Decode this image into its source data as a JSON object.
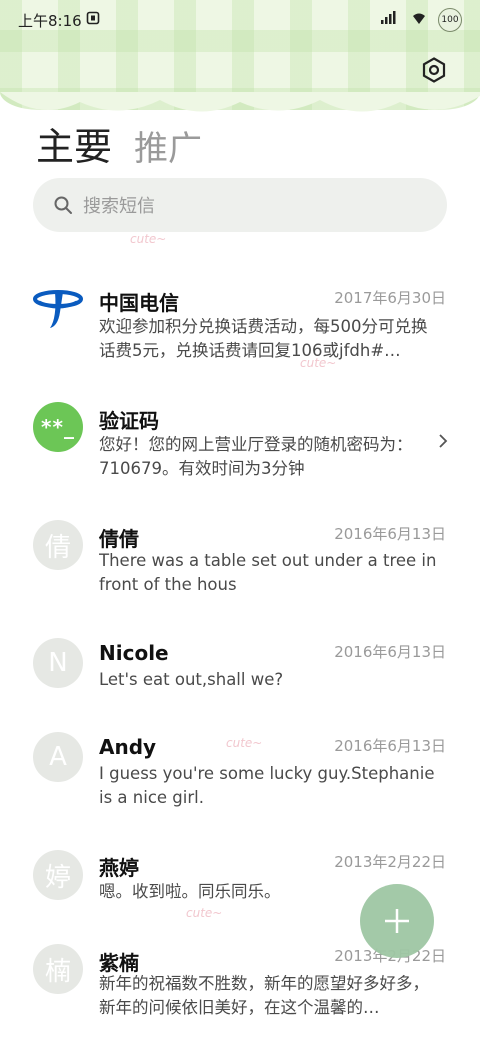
{
  "status": {
    "time": "上午8:16",
    "battery": "100"
  },
  "tabs": {
    "primary": "主要",
    "secondary": "推广"
  },
  "search": {
    "placeholder": "搜索短信"
  },
  "messages": [
    {
      "name": "中国电信",
      "date": "2017年6月30日",
      "snippet": "欢迎参加积分兑换话费活动，每500分可兑换话费5元，兑换话费请回复106或jfdh#…",
      "avatar": "",
      "avatar_type": "telecom-logo"
    },
    {
      "name": "验证码",
      "date": "",
      "snippet": "您好！您的网上营业厅登录的随机密码为：710679。有效时间为3分钟",
      "avatar": "**_",
      "avatar_type": "green"
    },
    {
      "name": "倩倩",
      "date": "2016年6月13日",
      "snippet": "There was a table set out under a tree in front of the hous",
      "avatar": "倩",
      "avatar_type": "gray"
    },
    {
      "name": "Nicole",
      "date": "2016年6月13日",
      "snippet": "Let's eat out,shall we?",
      "avatar": "N",
      "avatar_type": "gray"
    },
    {
      "name": "Andy",
      "date": "2016年6月13日",
      "snippet": "I guess you're some lucky guy.Stephanie is a nice girl.",
      "avatar": "A",
      "avatar_type": "gray"
    },
    {
      "name": "燕婷",
      "date": "2013年2月22日",
      "snippet": "嗯。收到啦。同乐同乐。",
      "avatar": "婷",
      "avatar_type": "gray"
    },
    {
      "name": "紫楠",
      "date": "2013年2月22日",
      "snippet": "新年的祝福数不胜数，新年的愿望好多好多，新年的问候依旧美好，在这个温馨的…",
      "avatar": "楠",
      "avatar_type": "gray"
    }
  ],
  "decor": {
    "cute": "cute~"
  },
  "colors": {
    "fab": "#9fc7a4",
    "avatar_green": "#6cc656",
    "telecom_blue": "#0a5bbf"
  }
}
